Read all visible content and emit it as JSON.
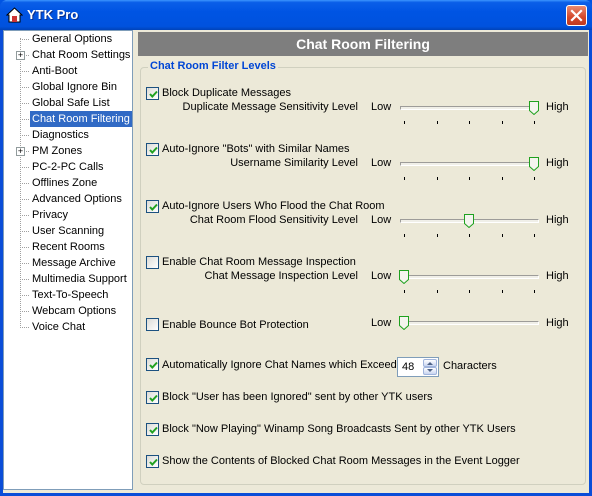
{
  "window": {
    "title": "YTK Pro",
    "close_icon": "close-icon"
  },
  "sidebar": {
    "items": [
      {
        "label": "General Options",
        "expander": false,
        "selected": false
      },
      {
        "label": "Chat Room Settings",
        "expander": true,
        "selected": false
      },
      {
        "label": "Anti-Boot",
        "expander": false,
        "selected": false
      },
      {
        "label": "Global Ignore Bin",
        "expander": false,
        "selected": false
      },
      {
        "label": "Global Safe List",
        "expander": false,
        "selected": false
      },
      {
        "label": "Chat Room Filtering",
        "expander": false,
        "selected": true
      },
      {
        "label": "Diagnostics",
        "expander": false,
        "selected": false
      },
      {
        "label": "PM Zones",
        "expander": true,
        "selected": false
      },
      {
        "label": "PC-2-PC Calls",
        "expander": false,
        "selected": false
      },
      {
        "label": "Offlines Zone",
        "expander": false,
        "selected": false
      },
      {
        "label": "Advanced Options",
        "expander": false,
        "selected": false
      },
      {
        "label": "Privacy",
        "expander": false,
        "selected": false
      },
      {
        "label": "User Scanning",
        "expander": false,
        "selected": false
      },
      {
        "label": "Recent Rooms",
        "expander": false,
        "selected": false
      },
      {
        "label": "Message Archive",
        "expander": false,
        "selected": false
      },
      {
        "label": "Multimedia Support",
        "expander": false,
        "selected": false
      },
      {
        "label": "Text-To-Speech",
        "expander": false,
        "selected": false
      },
      {
        "label": "Webcam Options",
        "expander": false,
        "selected": false
      },
      {
        "label": "Voice Chat",
        "expander": false,
        "selected": false
      }
    ]
  },
  "panel": {
    "header": "Chat Room Filtering",
    "group_title": "Chat Room Filter Levels",
    "low_label": "Low",
    "high_label": "High",
    "filters": [
      {
        "label": "Block Duplicate Messages",
        "checked": true,
        "slider_label": "Duplicate Message Sensitivity Level",
        "level": 1.0
      },
      {
        "label": "Auto-Ignore \"Bots\" with Similar Names",
        "checked": true,
        "slider_label": "Username Similarity Level",
        "level": 1.0
      },
      {
        "label": "Auto-Ignore Users Who Flood the Chat Room",
        "checked": true,
        "slider_label": "Chat Room Flood Sensitivity Level",
        "level": 0.5
      },
      {
        "label": "Enable Chat Room Message Inspection",
        "checked": false,
        "slider_label": "Chat Message Inspection Level",
        "level": 0.0
      }
    ],
    "bounce": {
      "label": "Enable Bounce Bot Protection",
      "checked": false,
      "level": 0.0
    },
    "ignore_names": {
      "label": "Automatically Ignore Chat Names which Exceed",
      "checked": true,
      "value": "48",
      "suffix": "Characters"
    },
    "options": [
      {
        "label": "Block \"User has been Ignored\" sent by other YTK users",
        "checked": true
      },
      {
        "label": "Block \"Now Playing\" Winamp Song Broadcasts Sent by other YTK Users",
        "checked": true
      },
      {
        "label": "Show the Contents of Blocked Chat Room Messages in the Event Logger",
        "checked": true
      }
    ]
  }
}
